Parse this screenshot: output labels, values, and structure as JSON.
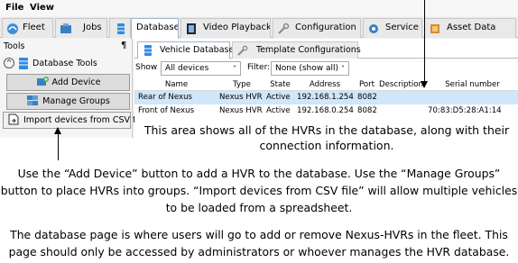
{
  "menu": {
    "file": "File",
    "view": "View"
  },
  "main_tabs": [
    {
      "label": "Fleet",
      "icon": "fleet-icon"
    },
    {
      "label": "Jobs",
      "icon": "jobs-icon"
    },
    {
      "label": "Database",
      "icon": "database-icon",
      "active": true
    },
    {
      "label": "Video Playback",
      "icon": "film-icon"
    },
    {
      "label": "Configuration",
      "icon": "wrench-icon"
    },
    {
      "label": "Service",
      "icon": "gear-icon"
    },
    {
      "label": "Asset Data",
      "icon": "asset-icon"
    }
  ],
  "tools_panel": {
    "title": "Tools",
    "pin": "¶",
    "tree_label": "Database Tools",
    "collapse_symbol": "^",
    "add_device": "Add Device",
    "manage_groups": "Manage Groups",
    "import_csv": "Import devices from CSV file"
  },
  "sub_tabs": [
    {
      "label": "Vehicle Database",
      "active": true
    },
    {
      "label": "Template Configurations"
    }
  ],
  "filter": {
    "show_label": "Show",
    "show_value": "All devices",
    "filter_label": "Filter:",
    "filter_value": "None (show all)",
    "chevron": "˅"
  },
  "grid": {
    "columns": [
      "Name",
      "Type",
      "State",
      "Address",
      "Port",
      "Description",
      "Serial number"
    ],
    "rows": [
      {
        "name": "Rear of Nexus",
        "type": "Nexus HVR",
        "state": "Active",
        "address": "192.168.1.254",
        "port": "8082",
        "description": "",
        "serial": "",
        "selected": true
      },
      {
        "name": "Front of Nexus",
        "type": "Nexus HVR",
        "state": "Active",
        "address": "192.168.0.254",
        "port": "8082",
        "description": "",
        "serial": "70:83:D5:28:A1:14",
        "selected": false
      }
    ]
  },
  "overlay_caption": "This area shows all of the HVRs in the database, along with their connection information.",
  "caption_1": "Use the “Add Device” button to add a HVR to the database.  Use the “Manage Groups” button to place HVRs into groups. “Import devices from CSV file” will allow multiple vehicles to be loaded from a spreadsheet.",
  "caption_2": "The database page is where users will go to add or remove Nexus-HVRs in the fleet.  This page should only be accessed by administrators or whoever manages the HVR database.",
  "colors": {
    "selected_row": "#cfe6fb",
    "active_tab_border": "#9cb4d4",
    "button_face": "#dcdcdc"
  }
}
